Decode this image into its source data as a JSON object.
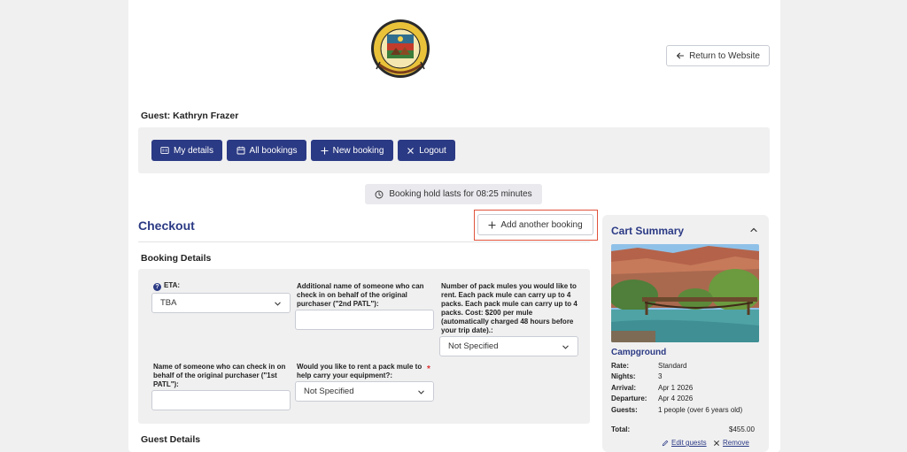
{
  "header": {
    "return_label": "Return to Website",
    "guest_label": "Guest: Kathryn Frazer"
  },
  "nav": {
    "my_details": "My details",
    "all_bookings": "All bookings",
    "new_booking": "New booking",
    "logout": "Logout"
  },
  "hold": {
    "text": "Booking hold lasts for 08:25 minutes"
  },
  "checkout": {
    "title": "Checkout",
    "add_another": "Add another booking",
    "booking_details_title": "Booking Details",
    "guest_details_title": "Guest Details"
  },
  "form": {
    "eta_label": "ETA:",
    "eta_value": "TBA",
    "second_patl_label": "Additional name of someone who can check in on behalf of the original purchaser (\"2nd PATL\"):",
    "second_patl_value": "",
    "mules_label": "Number of pack mules you would like to rent. Each pack mule can carry up to 4 packs. Each pack mule can carry up to 4 packs. Cost: $200 per mule (automatically charged 48 hours before your trip date).:",
    "mules_value": "Not Specified",
    "first_patl_label": "Name of someone who can check in on behalf of the original purchaser (\"1st PATL\"):",
    "first_patl_value": "",
    "rent_mule_label": "Would you like to rent a pack mule to help carry your equipment?:",
    "rent_mule_required": "*",
    "rent_mule_value": "Not Specified"
  },
  "cart": {
    "title": "Cart Summary",
    "item_name": "Campground",
    "rows": [
      {
        "k": "Rate:",
        "v": "Standard"
      },
      {
        "k": "Nights:",
        "v": "3"
      },
      {
        "k": "Arrival:",
        "v": "Apr 1 2026"
      },
      {
        "k": "Departure:",
        "v": "Apr 4 2026"
      },
      {
        "k": "Guests:",
        "v": "1 people (over 6 years old)"
      }
    ],
    "total_label": "Total:",
    "total_value": "$455.00",
    "edit_guests": "Edit guests",
    "remove": "Remove"
  },
  "colors": {
    "brand": "#2b3a84",
    "highlight": "#e0533c",
    "panel": "#f0f0f1"
  },
  "icons": {
    "return": "arrow-left-icon",
    "my_details": "id-card-icon",
    "all_bookings": "calendar-icon",
    "new_booking": "plus-icon",
    "logout": "close-icon",
    "hold": "clock-icon",
    "add_another": "plus-icon",
    "eta_help": "question-icon",
    "cart_collapse": "chevron-up-icon",
    "edit": "pencil-icon",
    "remove": "close-icon"
  }
}
